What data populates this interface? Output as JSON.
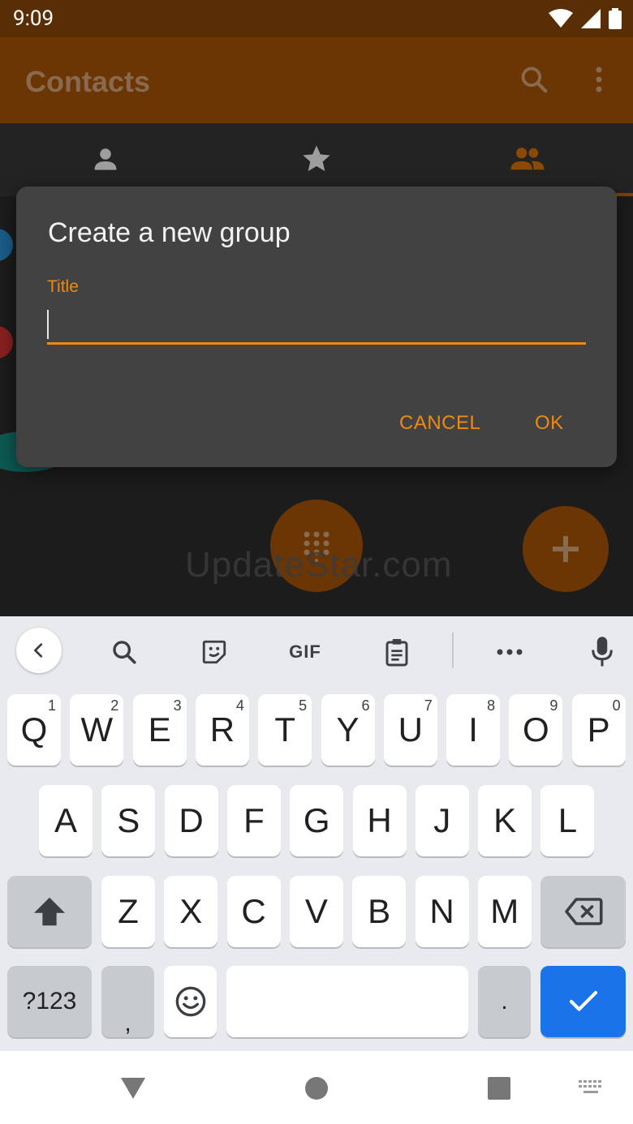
{
  "status_bar": {
    "time": "9:09"
  },
  "app_bar": {
    "title": "Contacts"
  },
  "tabs": [
    {
      "icon": "person-icon"
    },
    {
      "icon": "star-icon"
    },
    {
      "icon": "group-icon",
      "selected": true
    }
  ],
  "watermark": "UpdateStar.com",
  "dialog": {
    "title": "Create a new group",
    "field_label": "Title",
    "field_value": "",
    "cancel_label": "CANCEL",
    "ok_label": "OK"
  },
  "keyboard": {
    "toolbar": [
      "back-chevron-icon",
      "search-icon",
      "sticker-icon",
      "gif-icon",
      "clipboard-icon",
      "more-icon",
      "mic-icon"
    ],
    "gif_label": "GIF",
    "row1": [
      {
        "k": "Q",
        "h": "1"
      },
      {
        "k": "W",
        "h": "2"
      },
      {
        "k": "E",
        "h": "3"
      },
      {
        "k": "R",
        "h": "4"
      },
      {
        "k": "T",
        "h": "5"
      },
      {
        "k": "Y",
        "h": "6"
      },
      {
        "k": "U",
        "h": "7"
      },
      {
        "k": "I",
        "h": "8"
      },
      {
        "k": "O",
        "h": "9"
      },
      {
        "k": "P",
        "h": "0"
      }
    ],
    "row2": [
      "A",
      "S",
      "D",
      "F",
      "G",
      "H",
      "J",
      "K",
      "L"
    ],
    "row3": [
      "Z",
      "X",
      "C",
      "V",
      "B",
      "N",
      "M"
    ],
    "symbols_label": "?123",
    "comma_label": ",",
    "period_label": "."
  },
  "colors": {
    "accent": "#f0890f",
    "status_bar": "#5a2e04",
    "app_bar": "#6b3603",
    "dialog_bg": "#424242",
    "enter_key": "#1a73e8"
  }
}
